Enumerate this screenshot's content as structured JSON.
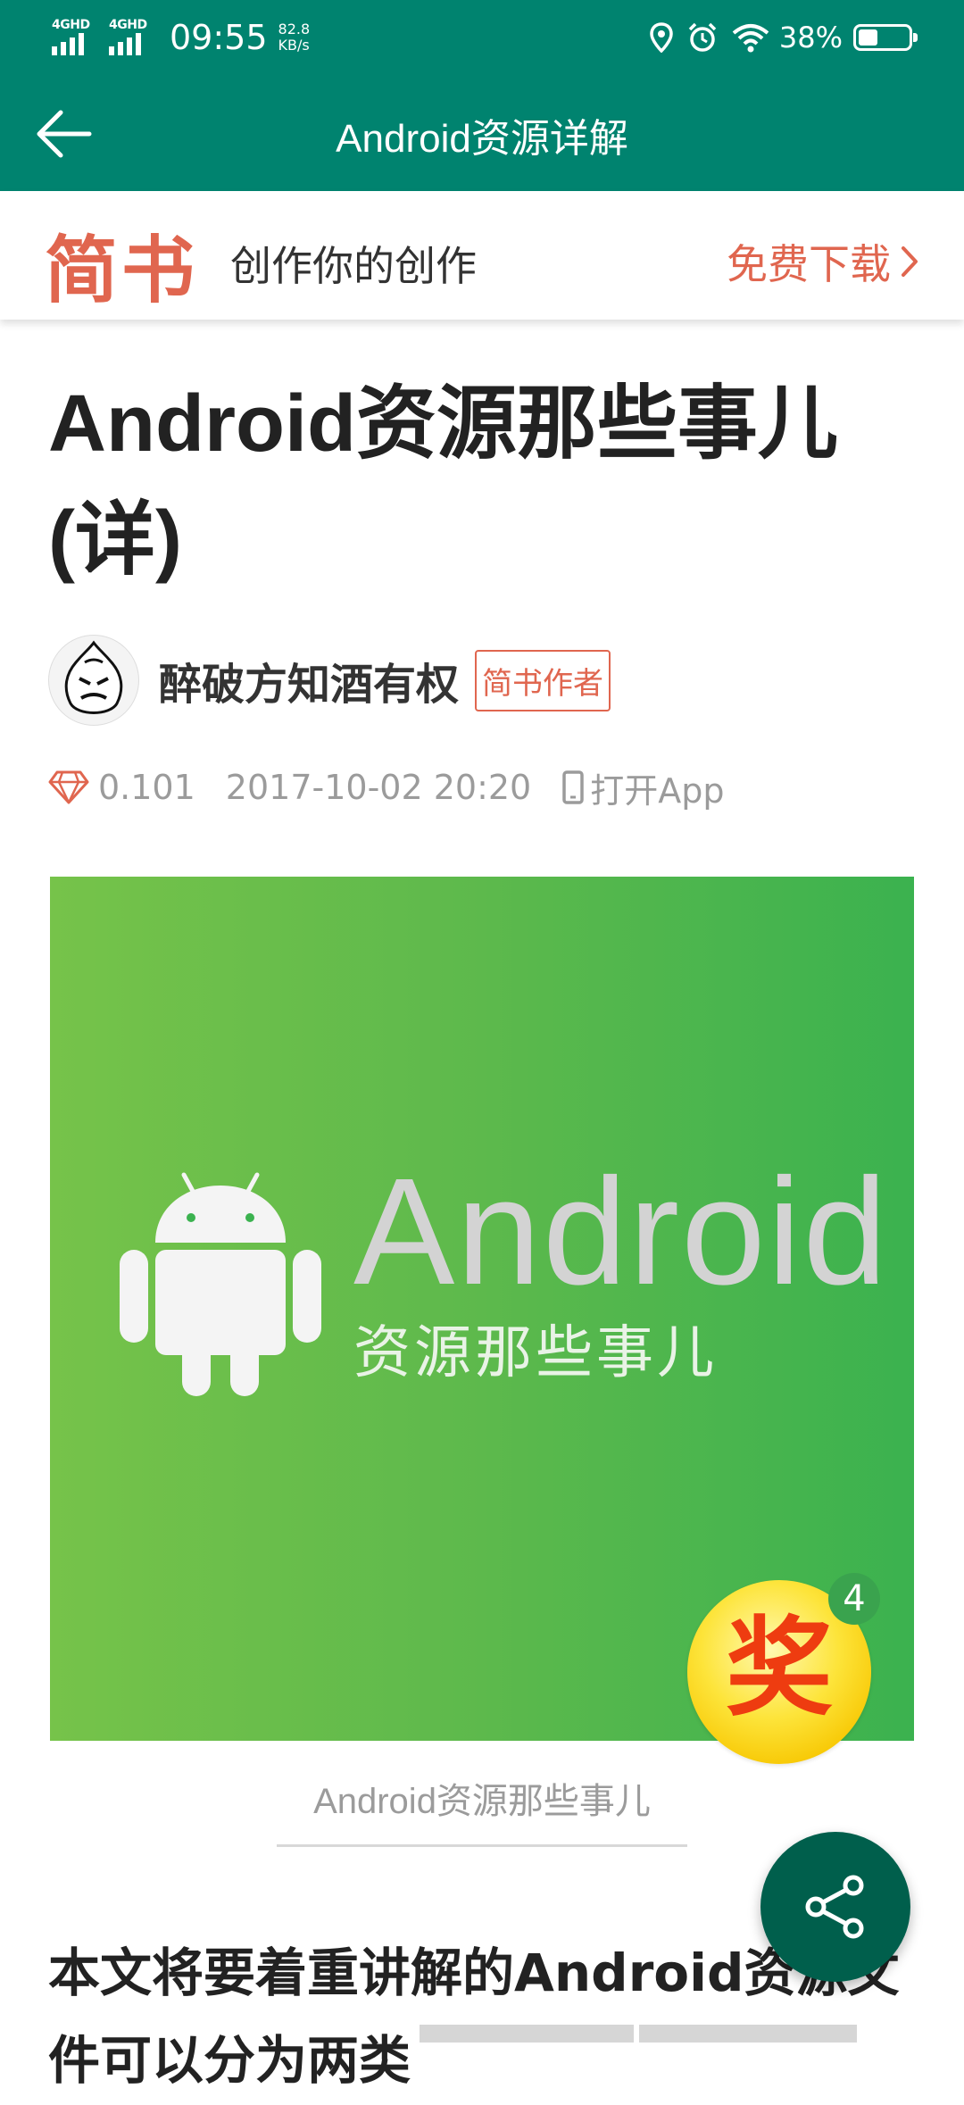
{
  "status_bar": {
    "sim1": "4GHD",
    "sim2": "4GHD",
    "time": "09:55",
    "net_speed_value": "82.8",
    "net_speed_unit": "KB/s",
    "battery_percent": "38%",
    "battery_level": 0.38
  },
  "toolbar": {
    "title": "Android资源详解",
    "color": "#00836f"
  },
  "banner": {
    "logo": "简书",
    "slogan": "创作你的创作",
    "download": "免费下载",
    "accent": "#e0664f"
  },
  "article": {
    "title": "Android资源那些事儿(详)",
    "author": "醉破方知酒有权",
    "author_badge": "简书作者",
    "diamonds": "0.101",
    "date": "2017-10-02 20:20",
    "open_app": "打开App",
    "hero_title": "Android",
    "hero_subtitle": "资源那些事儿",
    "caption": "Android资源那些事儿",
    "body_line1": "本文将要着重讲解的Android资源文",
    "body_line2": "件可以分为两类"
  },
  "award": {
    "glyph": "奖",
    "count": "4"
  },
  "icons": {
    "back": "arrow-left-icon",
    "location": "location-icon",
    "alarm": "alarm-icon",
    "wifi": "wifi-icon",
    "battery": "battery-icon",
    "chevron": "chevron-right-icon",
    "diamond": "diamond-icon",
    "phone": "phone-icon",
    "share": "share-icon",
    "android": "android-robot-icon"
  }
}
